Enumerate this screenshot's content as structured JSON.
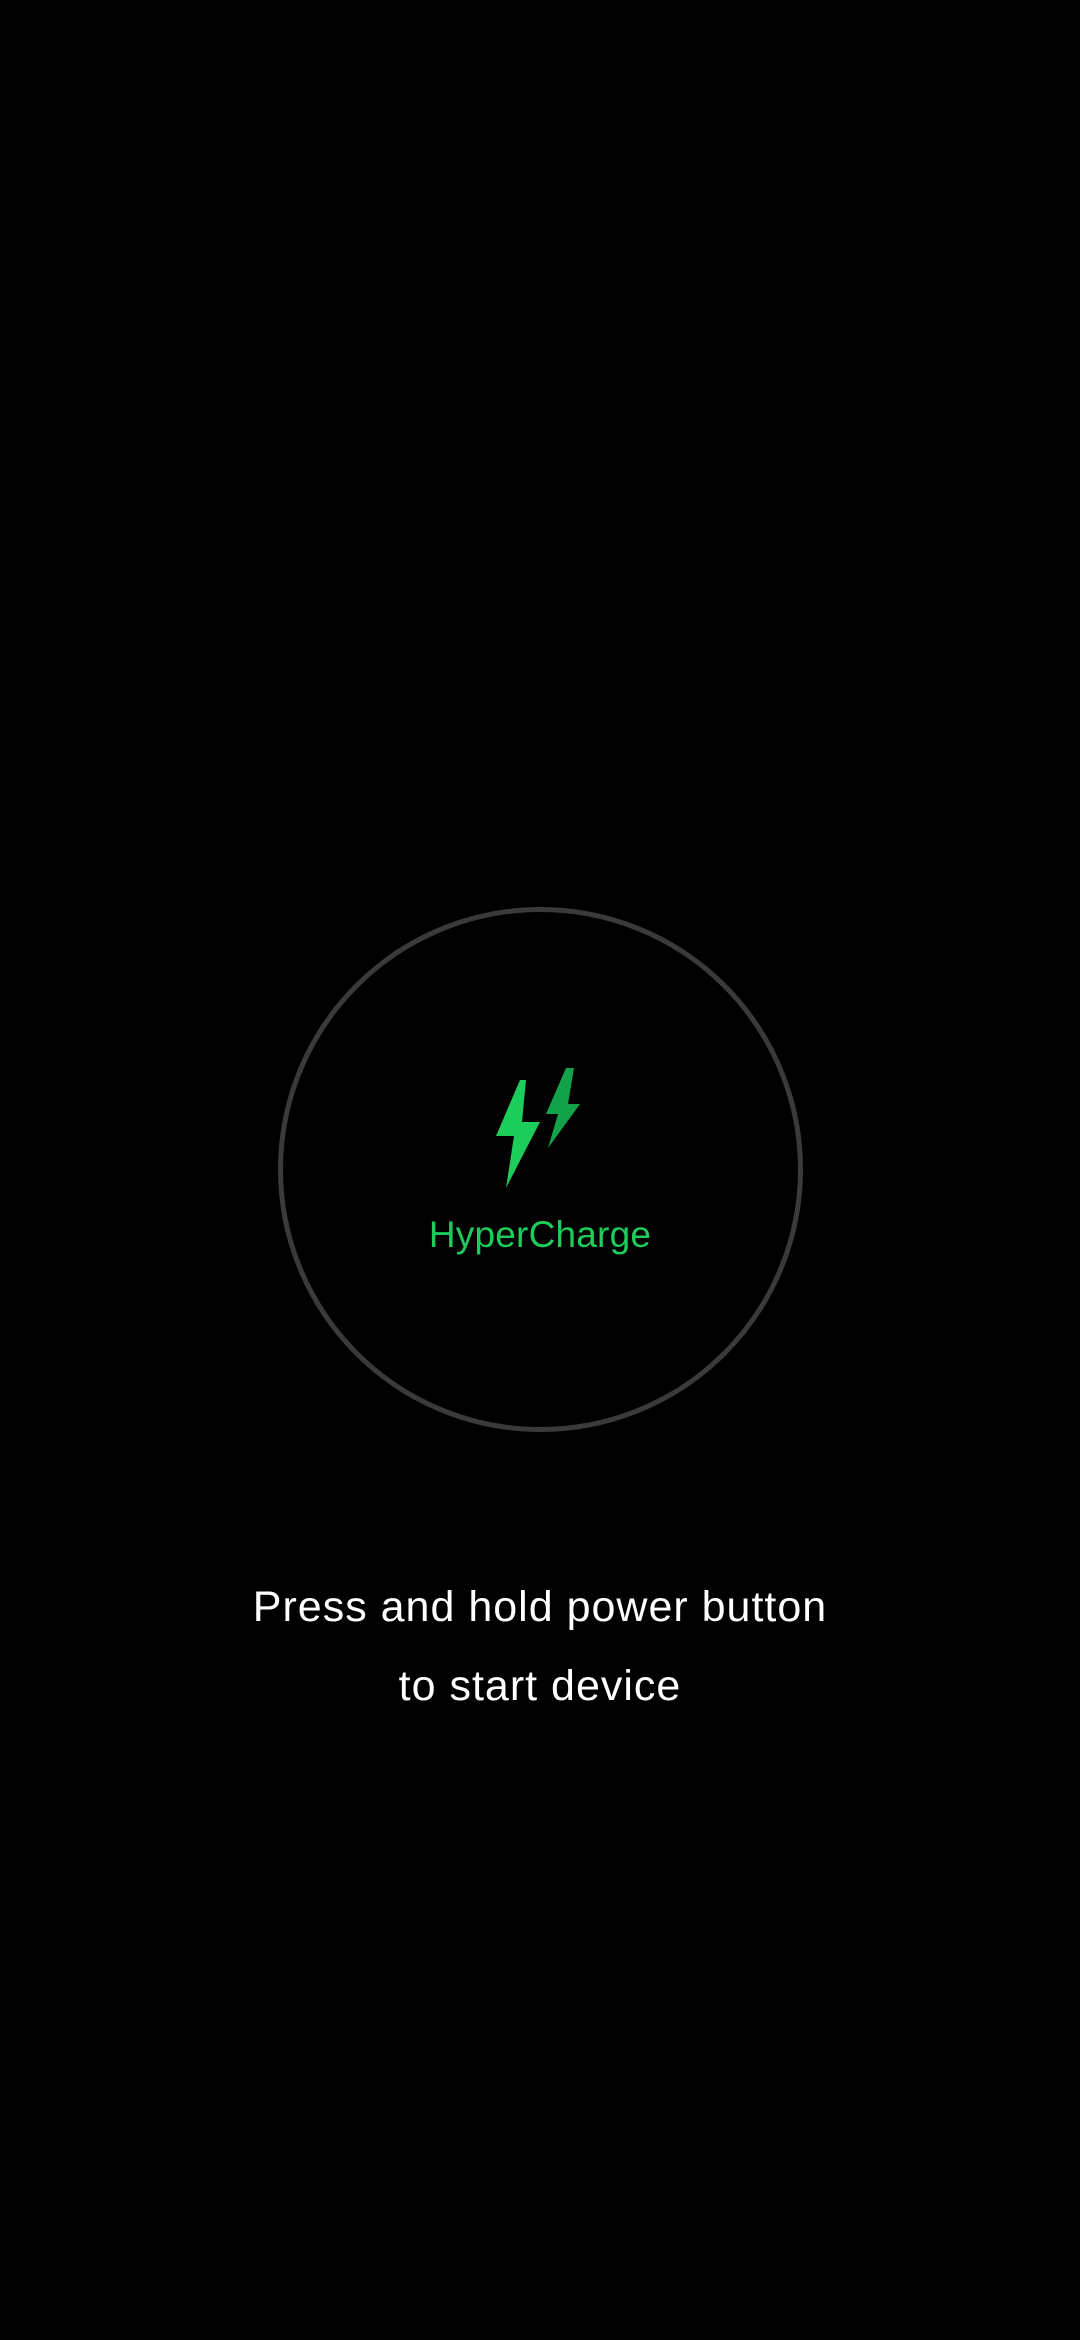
{
  "charging": {
    "mode_label": "HyperCharge",
    "icon": "double-lightning-bolt-icon",
    "accent_color": "#1ccd5c",
    "accent_color_secondary": "#12a34a",
    "ring_color": "#3a3a3a"
  },
  "instruction": {
    "line1": "Press and hold power button",
    "line2": "to start device"
  }
}
